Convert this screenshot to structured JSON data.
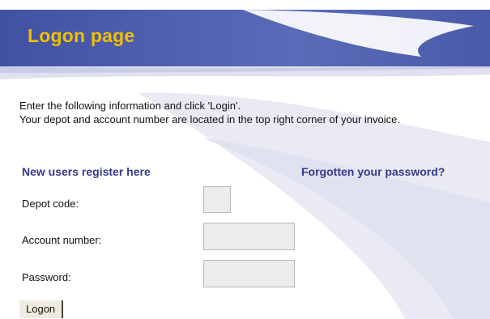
{
  "header": {
    "title": "Logon page"
  },
  "intro": {
    "line1": "Enter the following information and click 'Login'.",
    "line2": "Your depot and account number are located in the top right corner of your invoice."
  },
  "links": {
    "register": "New users register here",
    "forgot": "Forgotten your password?"
  },
  "form": {
    "depot_label": "Depot code:",
    "depot_value": "",
    "account_label": "Account number:",
    "account_value": "",
    "password_label": "Password:",
    "password_value": "",
    "submit_label": "Logon"
  },
  "colors": {
    "header_blue": "#4a5aa8",
    "title_yellow": "#f2c000",
    "link_blue": "#333a8c",
    "swoosh_lavender": "#e6e7f3"
  }
}
